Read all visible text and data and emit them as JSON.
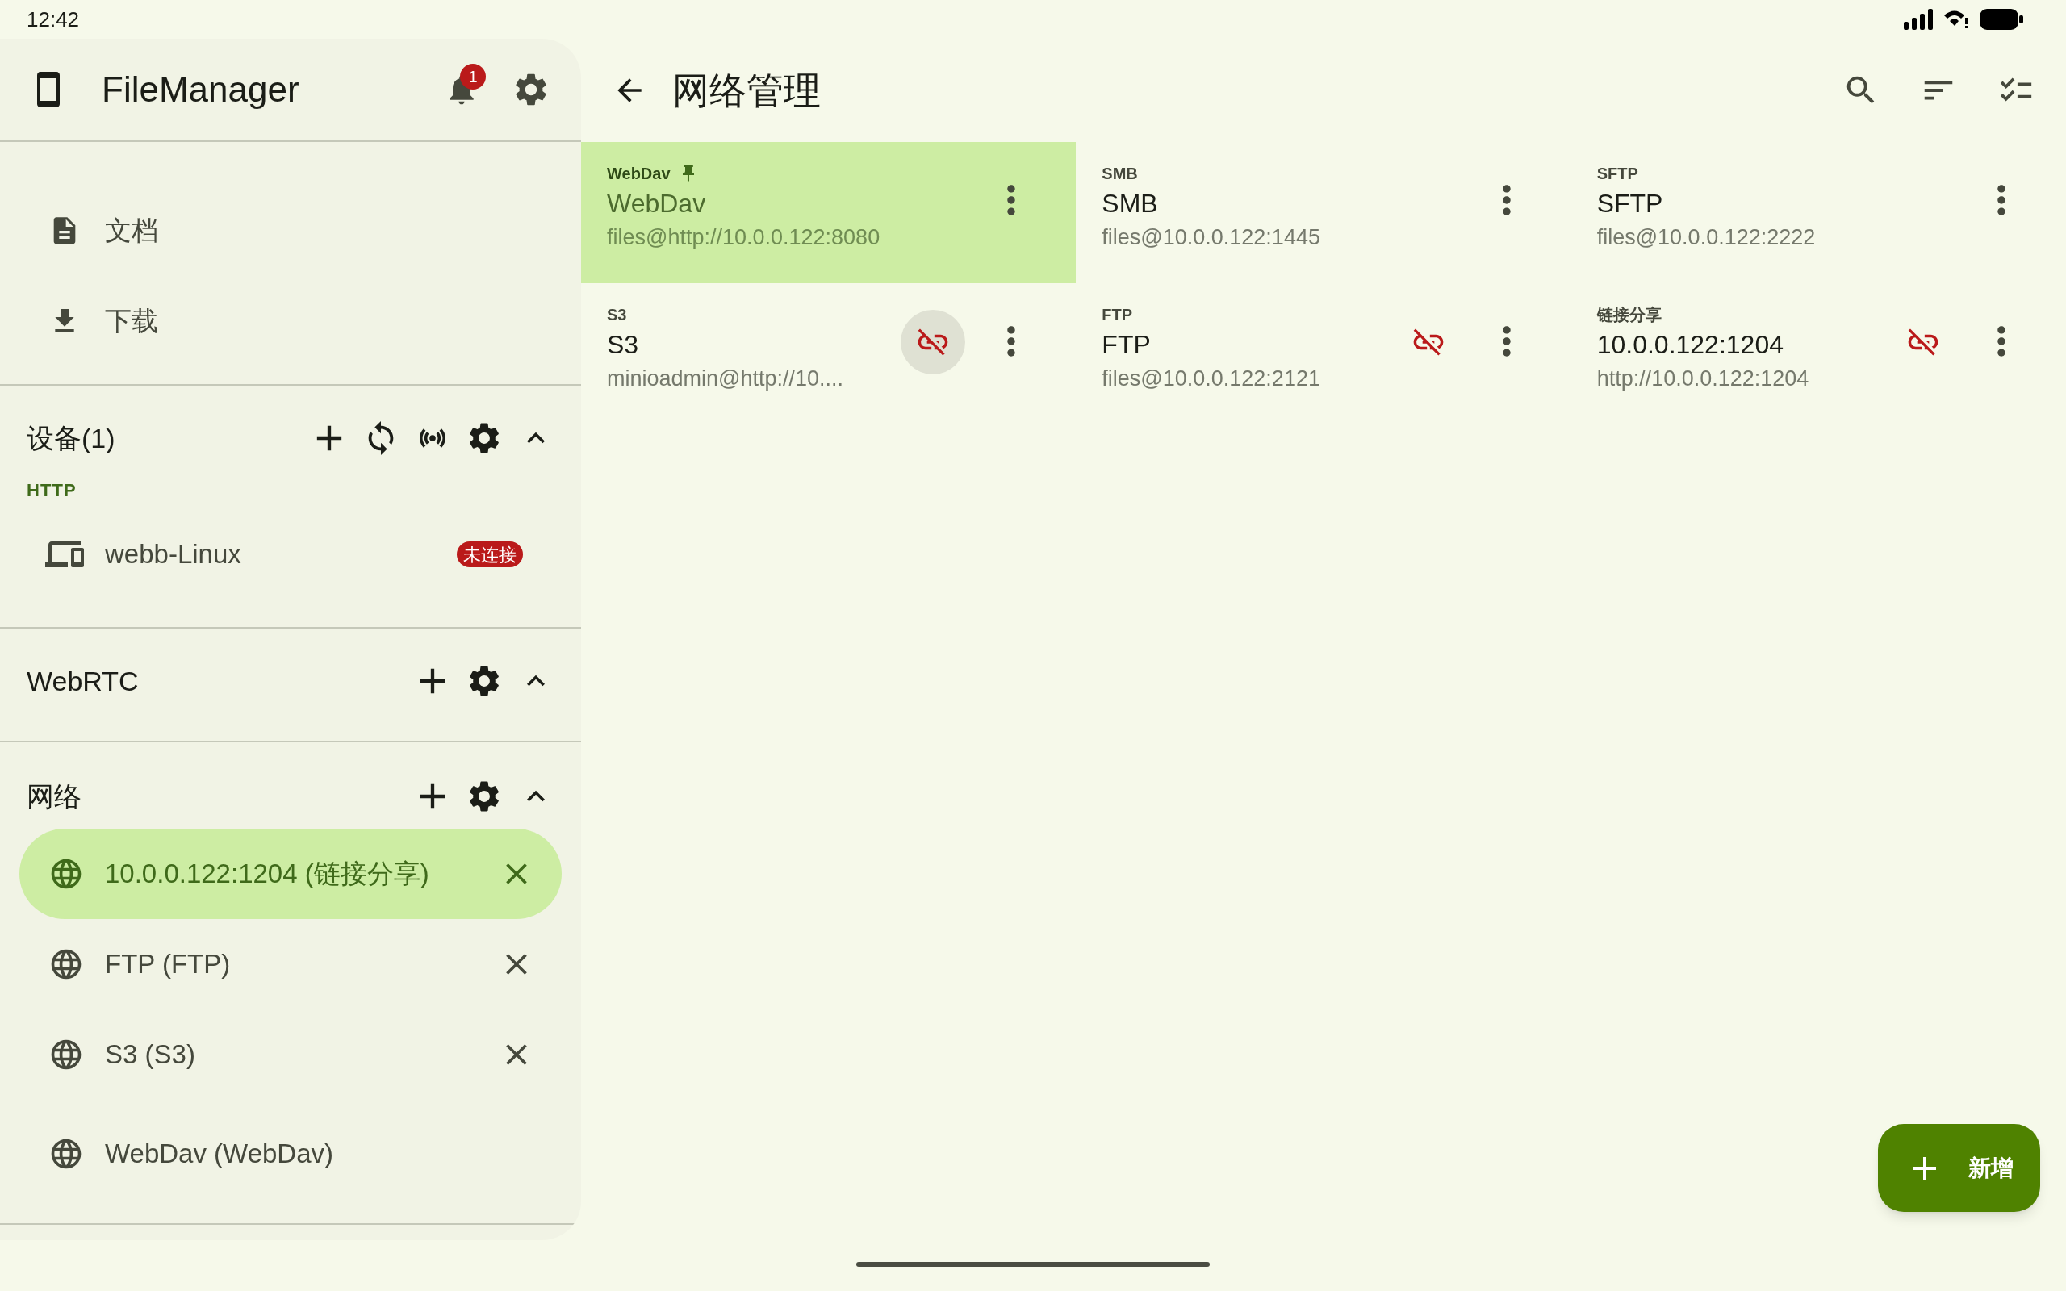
{
  "status_bar": {
    "time": "12:42"
  },
  "sidebar": {
    "title": "FileManager",
    "notification_badge": "1",
    "items": [
      {
        "kind": "document",
        "label": "文档"
      },
      {
        "kind": "download",
        "label": "下载"
      }
    ],
    "sections": [
      {
        "title": "设备(1)",
        "expanded": true,
        "actions": [
          {
            "kind": "add"
          },
          {
            "kind": "sync"
          },
          {
            "kind": "broadcast"
          },
          {
            "kind": "settings"
          }
        ],
        "groups": [
          {
            "label": "HTTP",
            "devices": [
              {
                "name": "webb-Linux",
                "status": "未连接",
                "connected": false
              }
            ]
          }
        ]
      },
      {
        "title": "WebRTC",
        "expanded": true,
        "actions": [
          {
            "kind": "add"
          },
          {
            "kind": "settings"
          }
        ]
      },
      {
        "title": "网络",
        "expanded": true,
        "actions": [
          {
            "kind": "add"
          },
          {
            "kind": "settings"
          }
        ],
        "connections": [
          {
            "label": "10.0.0.122:1204 (链接分享)",
            "selected": true,
            "closable": true
          },
          {
            "label": "FTP (FTP)",
            "selected": false,
            "closable": true
          },
          {
            "label": "S3 (S3)",
            "selected": false,
            "closable": true
          },
          {
            "label": "WebDav (WebDav)",
            "selected": false,
            "closable": false
          }
        ]
      }
    ]
  },
  "main": {
    "title": "网络管理",
    "cards": [
      {
        "type": "WebDav",
        "title": "WebDav",
        "address": "files@http://10.0.0.122:8080",
        "selected": true,
        "pinned": true,
        "disconnected": false
      },
      {
        "type": "SMB",
        "title": "SMB",
        "address": "files@10.0.0.122:1445",
        "selected": false,
        "pinned": false,
        "disconnected": false
      },
      {
        "type": "SFTP",
        "title": "SFTP",
        "address": "files@10.0.0.122:2222",
        "selected": false,
        "pinned": false,
        "disconnected": false
      },
      {
        "type": "S3",
        "title": "S3",
        "address": "minioadmin@http://10....",
        "selected": false,
        "pinned": false,
        "disconnected": true,
        "pressed": true
      },
      {
        "type": "FTP",
        "title": "FTP",
        "address": "files@10.0.0.122:2121",
        "selected": false,
        "pinned": false,
        "disconnected": true,
        "pressed": false
      },
      {
        "type": "链接分享",
        "title": "10.0.0.122:1204",
        "address": "http://10.0.0.122:1204",
        "selected": false,
        "pinned": false,
        "disconnected": true,
        "pressed": false
      }
    ],
    "fab": {
      "label": "新增"
    }
  }
}
